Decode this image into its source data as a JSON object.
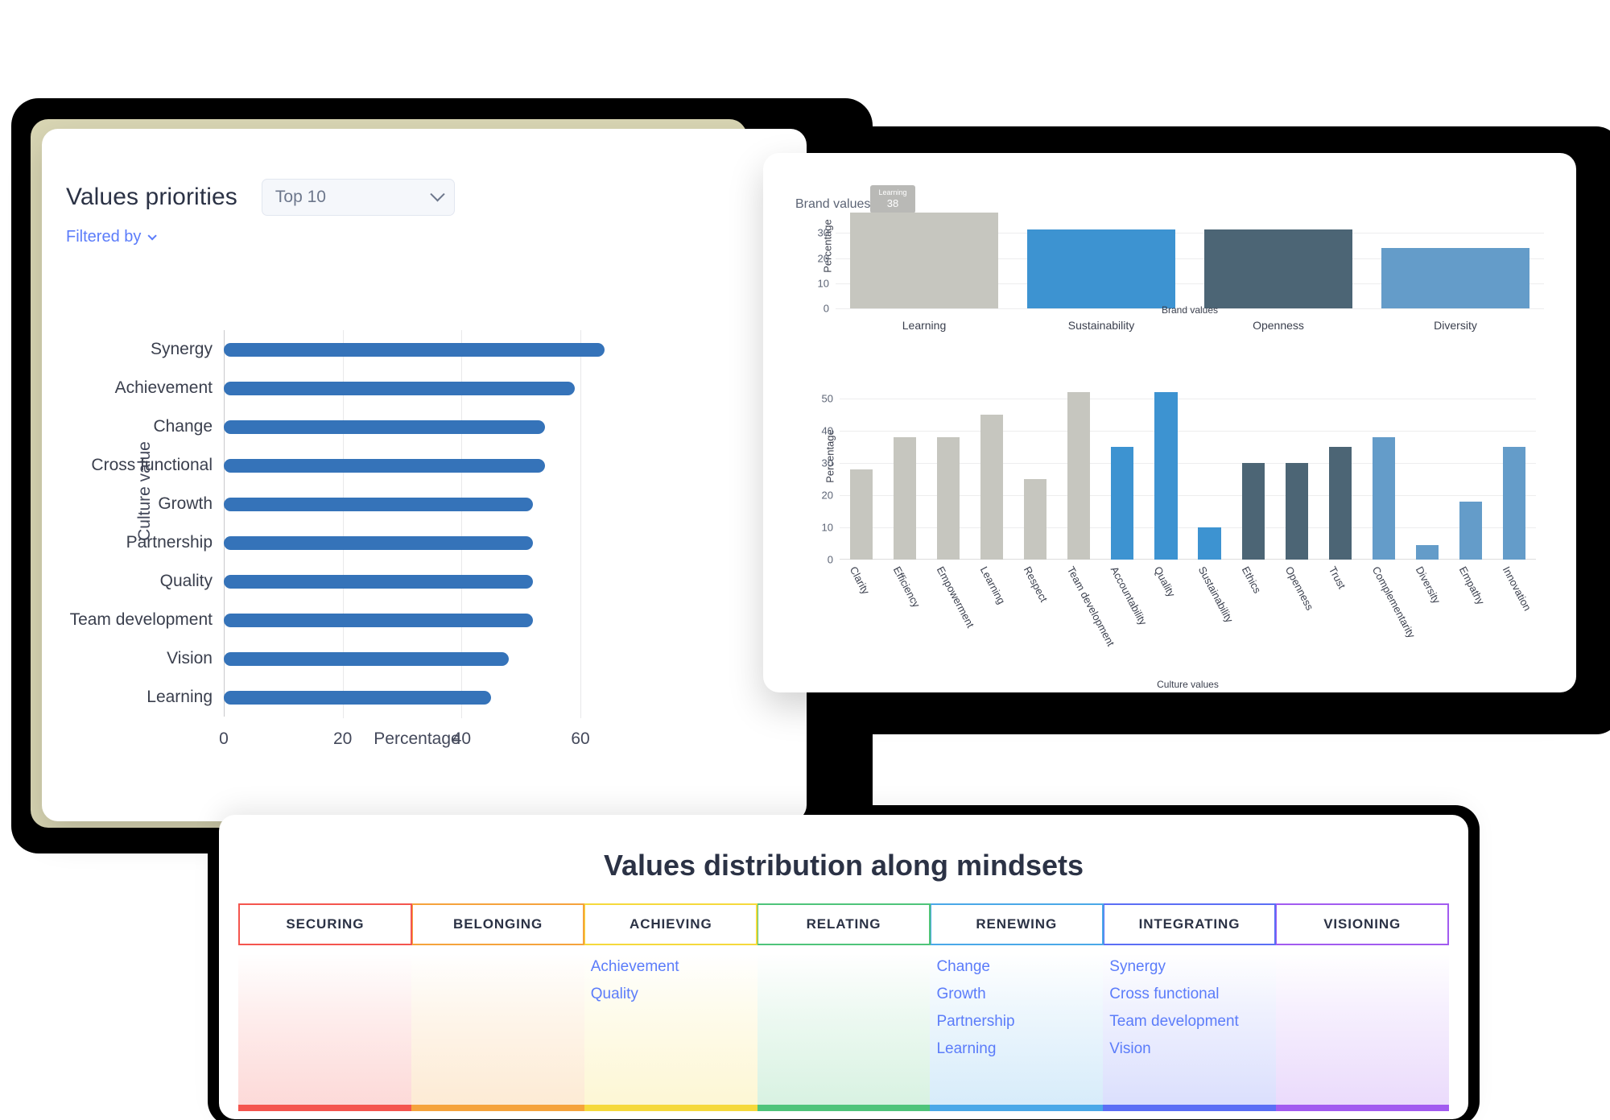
{
  "left_panel": {
    "title": "Values priorities",
    "select_value": "Top 10",
    "select_icon": "chevron-down-icon",
    "filter_link": "Filtered by",
    "filter_icon": "chevron-down-icon"
  },
  "right_panel": {
    "brand_caption": "Brand values",
    "tooltip": {
      "label": "Learning",
      "value": "38"
    }
  },
  "bottom_panel": {
    "title": "Values distribution along mindsets",
    "mindsets": [
      {
        "label": "SECURING",
        "color": "#f4554e",
        "items": []
      },
      {
        "label": "BELONGING",
        "color": "#f5a33c",
        "items": []
      },
      {
        "label": "ACHIEVING",
        "color": "#f5d93c",
        "items": [
          "Achievement",
          "Quality"
        ]
      },
      {
        "label": "RELATING",
        "color": "#4fc47a",
        "items": []
      },
      {
        "label": "RENEWING",
        "color": "#4aa8e8",
        "items": [
          "Change",
          "Growth",
          "Partnership",
          "Learning"
        ]
      },
      {
        "label": "INTEGRATING",
        "color": "#5b6ef5",
        "items": [
          "Synergy",
          "Cross functional",
          "Team development",
          "Vision"
        ]
      },
      {
        "label": "VISIONING",
        "color": "#a25bf0",
        "items": []
      }
    ],
    "item_color": "#5b7cfa"
  },
  "chart_data": [
    {
      "type": "bar",
      "orientation": "horizontal",
      "title": "Values priorities",
      "xlabel": "Percentage",
      "ylabel": "Culture value",
      "xlim": [
        0,
        65
      ],
      "xticks": [
        0,
        20,
        40,
        60
      ],
      "grid": true,
      "bar_color": "#3573b9",
      "categories": [
        "Synergy",
        "Achievement",
        "Change",
        "Cross functional",
        "Growth",
        "Partnership",
        "Quality",
        "Team development",
        "Vision",
        "Learning"
      ],
      "values": [
        64,
        59,
        54,
        54,
        52,
        52,
        52,
        52,
        48,
        45
      ]
    },
    {
      "type": "bar",
      "orientation": "vertical",
      "title": "Brand values",
      "xlabel": "Brand values",
      "ylabel": "Percentage",
      "ylim": [
        0,
        40
      ],
      "yticks": [
        0,
        10,
        20,
        30
      ],
      "grid": true,
      "categories": [
        "Learning",
        "Sustainability",
        "Openness",
        "Diversity"
      ],
      "values": [
        38,
        31.5,
        31.5,
        24
      ],
      "colors": [
        "#c6c6bf",
        "#3d93d1",
        "#4c6575",
        "#649cc9"
      ]
    },
    {
      "type": "bar",
      "orientation": "vertical",
      "title": "Culture values",
      "xlabel": "Culture values",
      "ylabel": "Percentage",
      "ylim": [
        0,
        55
      ],
      "yticks": [
        0,
        10,
        20,
        30,
        40,
        50
      ],
      "grid": true,
      "categories": [
        "Clarity",
        "Efficiency",
        "Empowerment",
        "Learning",
        "Respect",
        "Team development",
        "Accountability",
        "Quality",
        "Sustainability",
        "Ethics",
        "Openness",
        "Trust",
        "Complementarity",
        "Diversity",
        "Empathy",
        "Innovation"
      ],
      "values": [
        28,
        38,
        38,
        45,
        25,
        52,
        35,
        52,
        10,
        30,
        30,
        35,
        38,
        4.5,
        18,
        35
      ],
      "colors": [
        "#c6c6bf",
        "#c6c6bf",
        "#c6c6bf",
        "#c6c6bf",
        "#c6c6bf",
        "#c6c6bf",
        "#3d93d1",
        "#3d93d1",
        "#3d93d1",
        "#4c6575",
        "#4c6575",
        "#4c6575",
        "#649cc9",
        "#649cc9",
        "#649cc9",
        "#649cc9"
      ]
    }
  ]
}
